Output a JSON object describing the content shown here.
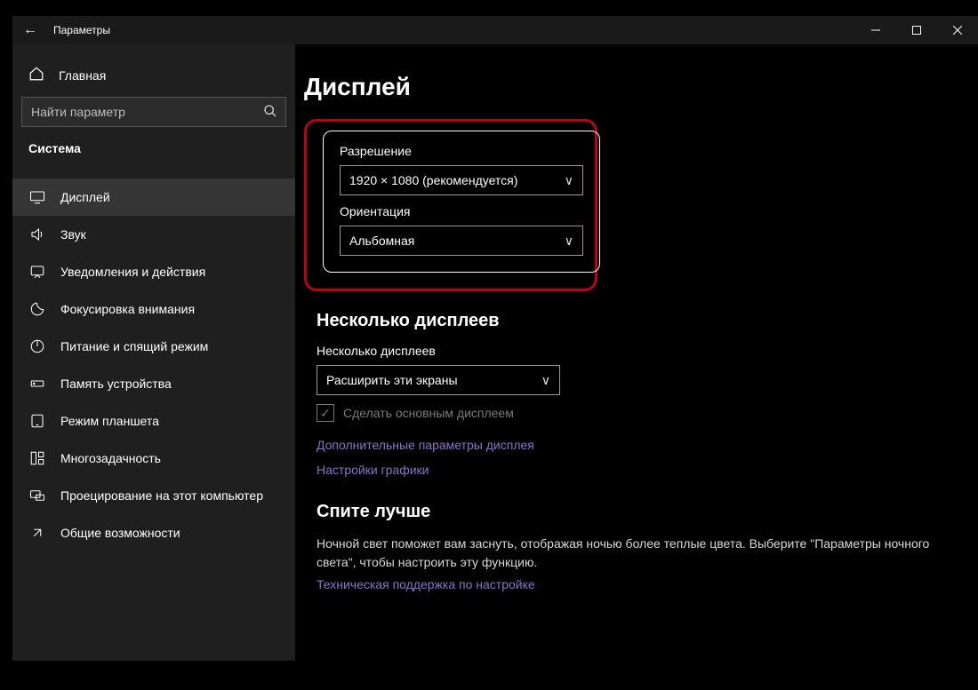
{
  "titlebar": {
    "title": "Параметры"
  },
  "sidebar": {
    "home_label": "Главная",
    "search_placeholder": "Найти параметр",
    "section_title": "Система",
    "items": [
      {
        "label": "Дисплей",
        "icon": "display"
      },
      {
        "label": "Звук",
        "icon": "sound"
      },
      {
        "label": "Уведомления и действия",
        "icon": "notifications"
      },
      {
        "label": "Фокусировка внимания",
        "icon": "focus"
      },
      {
        "label": "Питание и спящий режим",
        "icon": "power"
      },
      {
        "label": "Память устройства",
        "icon": "storage"
      },
      {
        "label": "Режим планшета",
        "icon": "tablet"
      },
      {
        "label": "Многозадачность",
        "icon": "multitask"
      },
      {
        "label": "Проецирование на этот компьютер",
        "icon": "project"
      },
      {
        "label": "Общие возможности",
        "icon": "shared"
      }
    ]
  },
  "main": {
    "page_title": "Дисплей",
    "resolution": {
      "label": "Разрешение",
      "value": "1920 × 1080 (рекомендуется)"
    },
    "orientation": {
      "label": "Ориентация",
      "value": "Альбомная"
    },
    "multi": {
      "section_title": "Несколько дисплеев",
      "label": "Несколько дисплеев",
      "value": "Расширить эти экраны",
      "checkbox_label": "Сделать основным дисплеем"
    },
    "links": {
      "advanced_display": "Дополнительные параметры дисплея",
      "graphics_settings": "Настройки графики"
    },
    "sleep_better": {
      "title": "Спите лучше",
      "body": "Ночной свет поможет вам заснуть, отображая ночью более теплые цвета. Выберите \"Параметры ночного света\", чтобы настроить эту функцию.",
      "support_link": "Техническая поддержка по настройке"
    }
  }
}
